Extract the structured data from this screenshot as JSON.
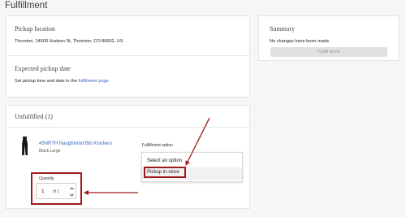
{
  "page": {
    "title": "Fulfillment"
  },
  "pickup_location": {
    "title": "Pickup location",
    "address": "Thornton, 14500 Hudson St, Thornton, CO 80602, US"
  },
  "expected_pickup": {
    "title": "Expected pickup date",
    "text": "Set pickup time and date in the ",
    "link": "fulfillment page"
  },
  "summary": {
    "title": "Summary",
    "text": "No changes have been made.",
    "button": "Fulfill items"
  },
  "unfulfilled": {
    "title": "Unfulfilled (1)",
    "item": {
      "name": "45NRTH Naughtvind Bib Knickers",
      "variant": "Black,Large"
    },
    "fulfillment_option": {
      "label": "Fulfillment option",
      "options": [
        "Select an option",
        "Pickup in-store"
      ],
      "selected": "Pickup in-store"
    },
    "quantity": {
      "label": "Quantity",
      "value": "1",
      "of": "of 1"
    }
  },
  "colors": {
    "accent_link": "#3b67c2",
    "annotation_red": "#9e1b1b",
    "page_background": "#f6f6f7"
  },
  "icons": [
    "bib-knickers-thumbnail",
    "chevron-up-icon",
    "chevron-down-icon",
    "annotation-arrow"
  ]
}
